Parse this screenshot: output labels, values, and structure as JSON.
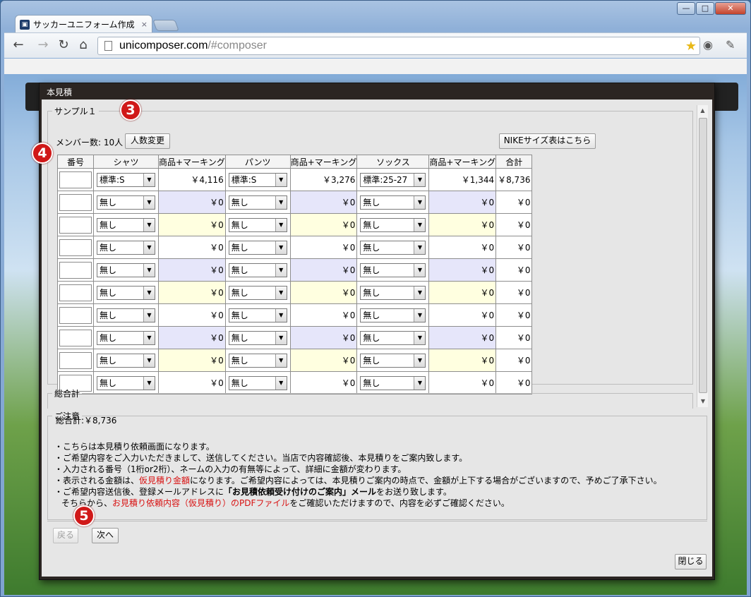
{
  "browser": {
    "tab_title": "サッカーユニフォーム作成",
    "tab_close": "×",
    "url_host": "unicomposer.com",
    "url_path": "/#composer",
    "win_min": "—",
    "win_max": "□",
    "win_close": "✕"
  },
  "modal": {
    "title": "本見積",
    "sample_legend": "サンプル１",
    "members_text": "メンバー数: 10人",
    "change_count_button": "人数変更",
    "nike_size_button": "NIKEサイズ表はこちら",
    "columns": [
      "番号",
      "シャツ",
      "商品+マーキング",
      "パンツ",
      "商品+マーキング",
      "ソックス",
      "商品+マーキング",
      "合計"
    ],
    "rows": [
      {
        "shirt": "標準:S",
        "shirt_price": "￥4,116",
        "pants": "標準:S",
        "pants_price": "￥3,276",
        "socks": "標準:25-27",
        "socks_price": "￥1,344",
        "total": "￥8,736"
      },
      {
        "shirt": "無し",
        "shirt_price": "￥0",
        "pants": "無し",
        "pants_price": "￥0",
        "socks": "無し",
        "socks_price": "￥0",
        "total": "￥0"
      },
      {
        "shirt": "無し",
        "shirt_price": "￥0",
        "pants": "無し",
        "pants_price": "￥0",
        "socks": "無し",
        "socks_price": "￥0",
        "total": "￥0"
      },
      {
        "shirt": "無し",
        "shirt_price": "￥0",
        "pants": "無し",
        "pants_price": "￥0",
        "socks": "無し",
        "socks_price": "￥0",
        "total": "￥0"
      },
      {
        "shirt": "無し",
        "shirt_price": "￥0",
        "pants": "無し",
        "pants_price": "￥0",
        "socks": "無し",
        "socks_price": "￥0",
        "total": "￥0"
      },
      {
        "shirt": "無し",
        "shirt_price": "￥0",
        "pants": "無し",
        "pants_price": "￥0",
        "socks": "無し",
        "socks_price": "￥0",
        "total": "￥0"
      },
      {
        "shirt": "無し",
        "shirt_price": "￥0",
        "pants": "無し",
        "pants_price": "￥0",
        "socks": "無し",
        "socks_price": "￥0",
        "total": "￥0"
      },
      {
        "shirt": "無し",
        "shirt_price": "￥0",
        "pants": "無し",
        "pants_price": "￥0",
        "socks": "無し",
        "socks_price": "￥0",
        "total": "￥0"
      },
      {
        "shirt": "無し",
        "shirt_price": "￥0",
        "pants": "無し",
        "pants_price": "￥0",
        "socks": "無し",
        "socks_price": "￥0",
        "total": "￥0"
      },
      {
        "shirt": "無し",
        "shirt_price": "￥0",
        "pants": "無し",
        "pants_price": "￥0",
        "socks": "無し",
        "socks_price": "￥0",
        "total": "￥0"
      }
    ],
    "total_legend": "総合計",
    "total_text": "総合計:￥8,736",
    "notes_legend": "ご注意",
    "notes": {
      "l1": "・こちらは本見積り依頼画面になります。",
      "l2": "・ご希望内容をご入力いただきまして、送信してください。当店で内容確認後、本見積りをご案内致します。",
      "l3": "・入力される番号（1桁or2桁）、ネームの入力の有無等によって、詳細に金額が変わります。",
      "l4a": "・表示される金額は、",
      "l4red": "仮見積り金額",
      "l4b": "になります。ご希望内容によっては、本見積りご案内の時点で、金額が上下する場合がございますので、予めご了承下さい。",
      "l5a": "・ご希望内容送信後、登録メールアドレスに",
      "l5bold": "「お見積依頼受け付けのご案内」メール",
      "l5b": "をお送り致します。",
      "l6a": "そちらから、",
      "l6red": "お見積り依頼内容（仮見積り）のPDFファイル",
      "l6b": "をご確認いただけますので、内容を必ずご確認ください。"
    },
    "back_button": "戻る",
    "next_button": "次へ",
    "close_button": "閉じる"
  },
  "badges": {
    "b3": "3",
    "b4": "4",
    "b5": "5"
  },
  "colors": {
    "badge": "#d01818",
    "blue_row": "#e6e6fa",
    "yellow_row": "#ffffe0",
    "red_text": "#d81010"
  }
}
